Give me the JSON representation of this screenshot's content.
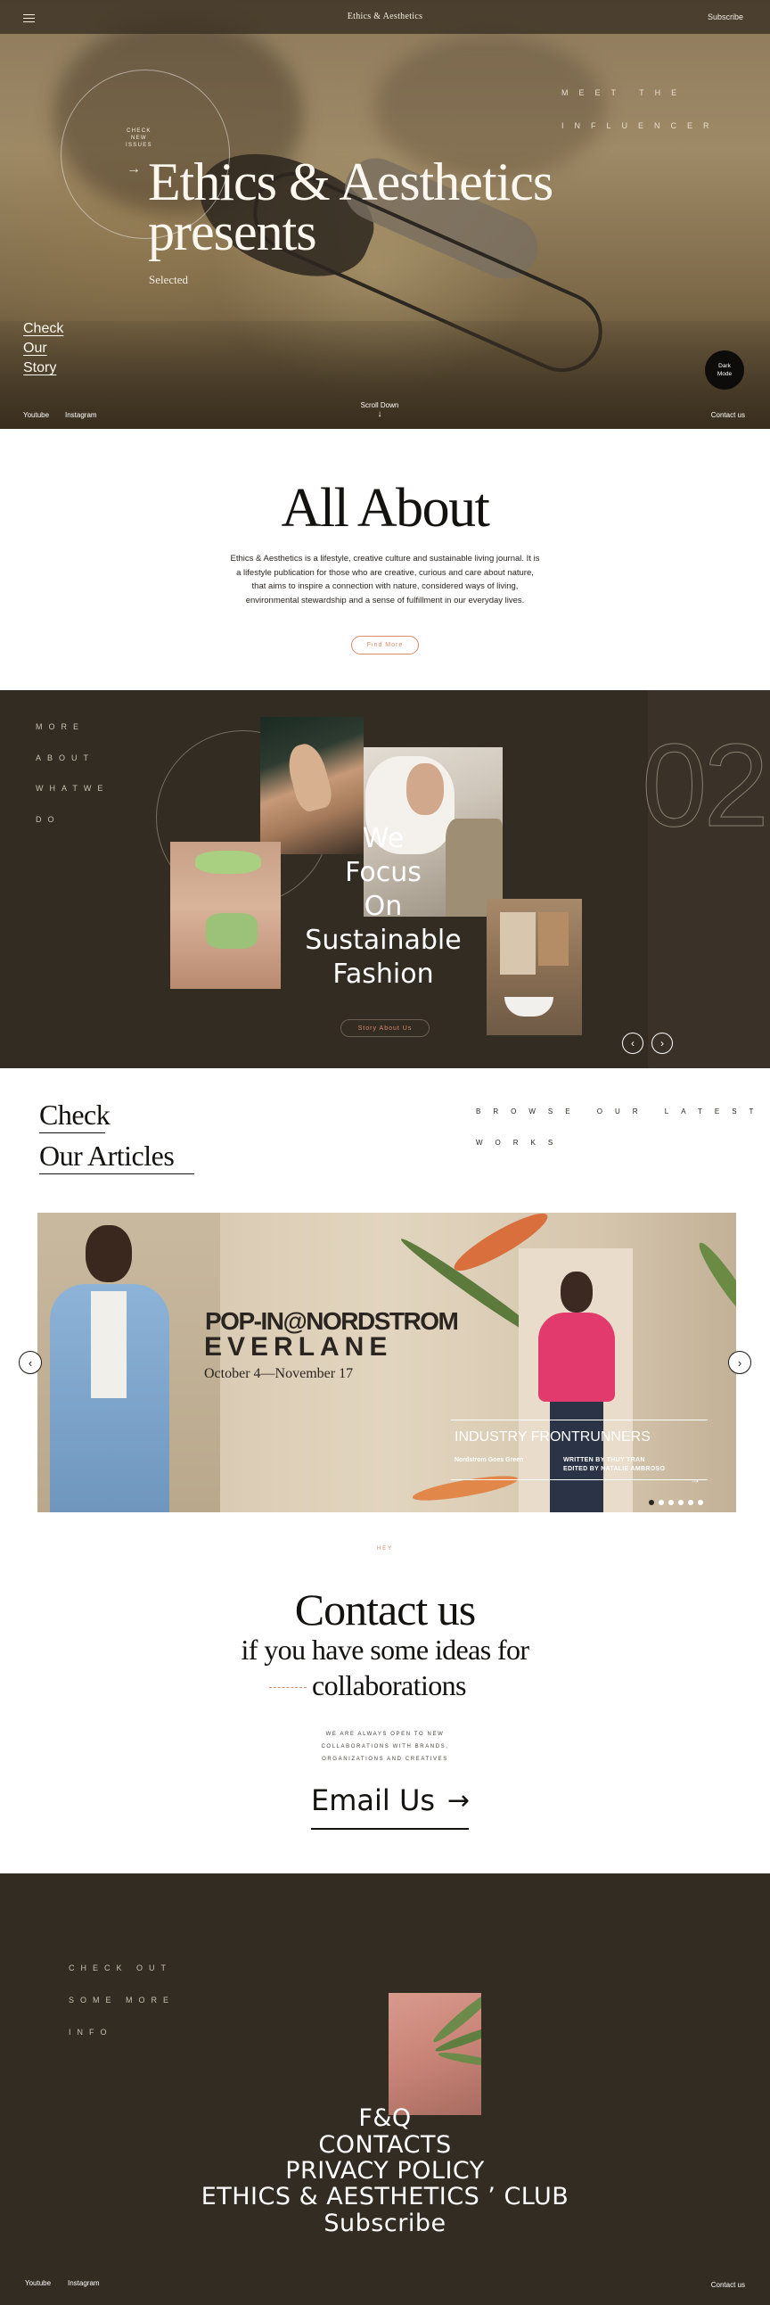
{
  "header": {
    "brand": "Ethics & Aesthetics",
    "subscribe": "Subscribe"
  },
  "hero": {
    "check_new_issues": [
      "CHECK",
      "NEW",
      "ISSUES"
    ],
    "meet_line1": "MEET THE",
    "meet_line2": "INFLUENCER",
    "title_line1": "Ethics & Aesthetics",
    "title_line2": "presents",
    "subtitle": "Selected",
    "story_lines": [
      "Check",
      "Our",
      "Story"
    ],
    "dark_mode": [
      "Dark",
      "Mode"
    ],
    "youtube": "Youtube",
    "instagram": "Instagram",
    "scroll_down": "Scroll Down",
    "contact": "Contact us"
  },
  "about": {
    "title": "All About",
    "body": "Ethics & Aesthetics is a lifestyle, creative culture and sustainable living journal. It is a lifestyle publication for those who are creative, curious and care about nature, that aims to inspire a connection with nature, considered ways of living, environmental stewardship and a sense of fulfillment in our everyday lives.",
    "button": "Find More"
  },
  "focus": {
    "side_lines": [
      "MORE",
      "ABOUT",
      "WHATWE",
      "DO"
    ],
    "big_number": "02",
    "headline": [
      "We",
      "Focus",
      "On",
      "Sustainable",
      "Fashion"
    ],
    "button": "Story About Us"
  },
  "articles": {
    "title_line1": "Check",
    "title_line2": "Our Articles",
    "browse_line1": "BROWSE OUR LATEST",
    "browse_line2": "WORKS",
    "slide": {
      "pop_in": "POP-IN@NORDSTROM",
      "brand": "EVERLANE",
      "dates": "October 4—November 17",
      "industry": "INDUSTRY FRONTRUNNERS",
      "subtitle": "Nordstrom Goes Green",
      "written_by": "WRITTEN BY THUY TRAN",
      "edited_by": "EDITED BY NATALIE AMBROSO"
    },
    "dots": 6
  },
  "contact": {
    "hey": "HEY",
    "title": "Contact us",
    "line2": "if you have some ideas for",
    "line3": "collaborations",
    "small": [
      "WE ARE ALWAYS OPEN TO NEW",
      "COLLABORATIONS WITH BRANDS,",
      "ORGANIZATIONS AND CREATIVES"
    ],
    "email": "Email Us"
  },
  "footer": {
    "side_lines": [
      "CHECK OUT",
      "SOME MORE",
      "INFO"
    ],
    "links": [
      "F&Q",
      "CONTACTS",
      "PRIVACY POLICY",
      "ETHICS & AESTHETICS ’ CLUB",
      "Subscribe"
    ],
    "youtube": "Youtube",
    "instagram": "Instagram",
    "contact": "Contact us"
  },
  "colors": {
    "dark_bg": "#332c22",
    "accent": "#d98a6a",
    "hero_tone": "#8d7a5c"
  }
}
